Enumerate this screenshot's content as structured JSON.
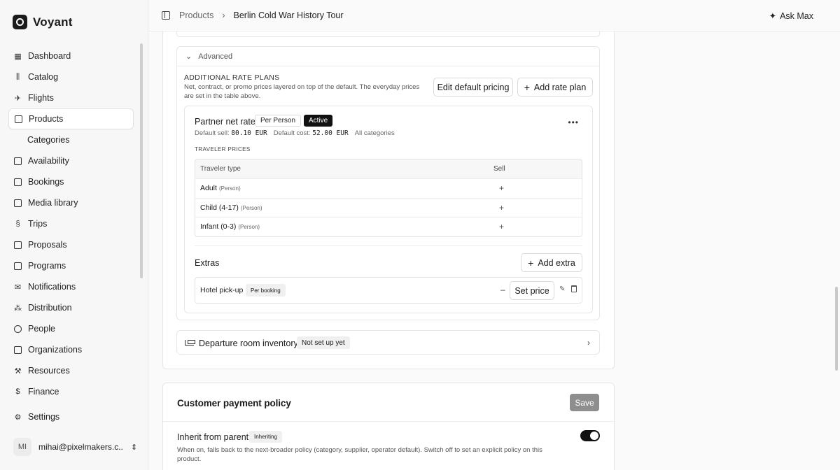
{
  "brand": {
    "name": "Voyant"
  },
  "sidebar": {
    "items": [
      {
        "label": "Dashboard",
        "icon": "dashboard-icon"
      },
      {
        "label": "Catalog",
        "icon": "catalog-icon"
      },
      {
        "label": "Flights",
        "icon": "plane-icon"
      },
      {
        "label": "Products",
        "icon": "package-icon",
        "active": true
      },
      {
        "label": "Categories",
        "sub": true
      },
      {
        "label": "Availability",
        "icon": "calendar-icon"
      },
      {
        "label": "Bookings",
        "icon": "calendar-check-icon"
      },
      {
        "label": "Media library",
        "icon": "image-icon"
      },
      {
        "label": "Trips",
        "icon": "route-icon"
      },
      {
        "label": "Proposals",
        "icon": "document-icon"
      },
      {
        "label": "Programs",
        "icon": "calendar-grid-icon"
      },
      {
        "label": "Notifications",
        "icon": "mail-icon"
      },
      {
        "label": "Distribution",
        "icon": "network-icon"
      },
      {
        "label": "People",
        "icon": "users-icon"
      },
      {
        "label": "Organizations",
        "icon": "building-icon"
      },
      {
        "label": "Resources",
        "icon": "wrench-icon"
      },
      {
        "label": "Finance",
        "icon": "dollar-icon"
      }
    ],
    "settings": "Settings",
    "user": {
      "initials": "MI",
      "email": "mihai@pixelmakers.c..."
    }
  },
  "topbar": {
    "breadcrumb": [
      "Products",
      "Berlin Cold War History Tour"
    ],
    "ask": "Ask Max"
  },
  "advanced": {
    "label": "Advanced",
    "rate_plans_title": "ADDITIONAL RATE PLANS",
    "rate_plans_desc": "Net, contract, or promo prices layered on top of the default. The everyday prices are set in the table above.",
    "edit_default": "Edit default pricing",
    "add_rate_plan": "Add rate plan",
    "plan": {
      "name": "Partner net rate",
      "unit": "Per Person",
      "status": "Active",
      "default_sell_label": "Default sell:",
      "default_sell": "80.10 EUR",
      "default_cost_label": "Default cost:",
      "default_cost": "52.00 EUR",
      "categories": "All categories",
      "traveler_prices_label": "TRAVELER PRICES",
      "col_type": "Traveler type",
      "col_sell": "Sell",
      "rows": [
        {
          "type": "Adult",
          "unit": "(Person)",
          "sell": "+"
        },
        {
          "type": "Child (4-17)",
          "unit": "(Person)",
          "sell": "+"
        },
        {
          "type": "Infant (0-3)",
          "unit": "(Person)",
          "sell": "+"
        }
      ],
      "extras_title": "Extras",
      "add_extra": "Add extra",
      "extra": {
        "name": "Hotel pick-up",
        "unit": "Per booking",
        "price": "–",
        "set_price": "Set price"
      }
    }
  },
  "departure": {
    "title": "Departure room inventory",
    "status": "Not set up yet"
  },
  "payment": {
    "title": "Customer payment policy",
    "save": "Save",
    "inherit_title": "Inherit from parent",
    "inherit_badge": "Inheriting",
    "inherit_desc": "When on, falls back to the next-broader policy (category, supplier, operator default). Switch off to set an explicit policy on this product.",
    "toggle_on": true
  }
}
